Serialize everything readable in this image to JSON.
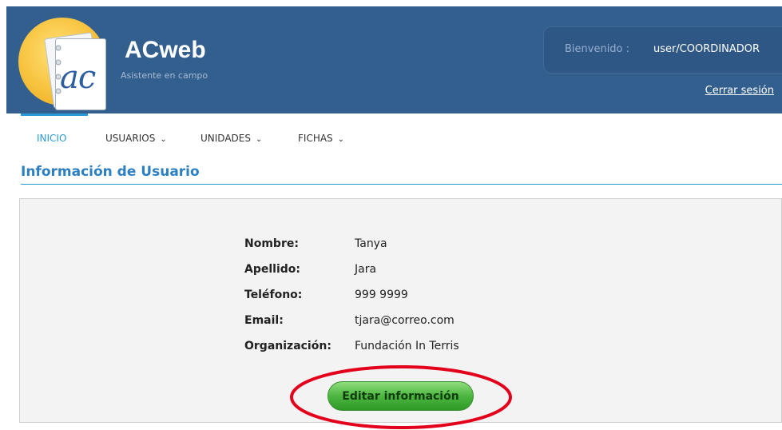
{
  "brand": {
    "name": "ACweb",
    "subtitle": "Asistente en campo",
    "logo_text": "ac"
  },
  "header": {
    "welcome_label": "Bienvenido :",
    "username": "user/COORDINADOR",
    "logout_label": "Cerrar sesión"
  },
  "nav": {
    "items": [
      {
        "label": "INICIO",
        "active": true
      },
      {
        "label": "USUARIOS",
        "has_dropdown": true
      },
      {
        "label": "UNIDADES",
        "has_dropdown": true
      },
      {
        "label": "FICHAS",
        "has_dropdown": true
      }
    ],
    "chevron": "⌄"
  },
  "section": {
    "title": "Información de Usuario"
  },
  "user_info": {
    "fields": [
      {
        "label": "Nombre:",
        "value": "Tanya"
      },
      {
        "label": "Apellido:",
        "value": "Jara"
      },
      {
        "label": "Teléfono:",
        "value": "999 9999"
      },
      {
        "label": "Email:",
        "value": "tjara@correo.com"
      },
      {
        "label": "Organización:",
        "value": "Fundación In Terris"
      }
    ],
    "edit_button": "Editar información"
  },
  "colors": {
    "header_bg": "#335f8f",
    "accent": "#2a9ad7",
    "button_green": "#4cb640",
    "annotation_red": "#e3001b"
  }
}
